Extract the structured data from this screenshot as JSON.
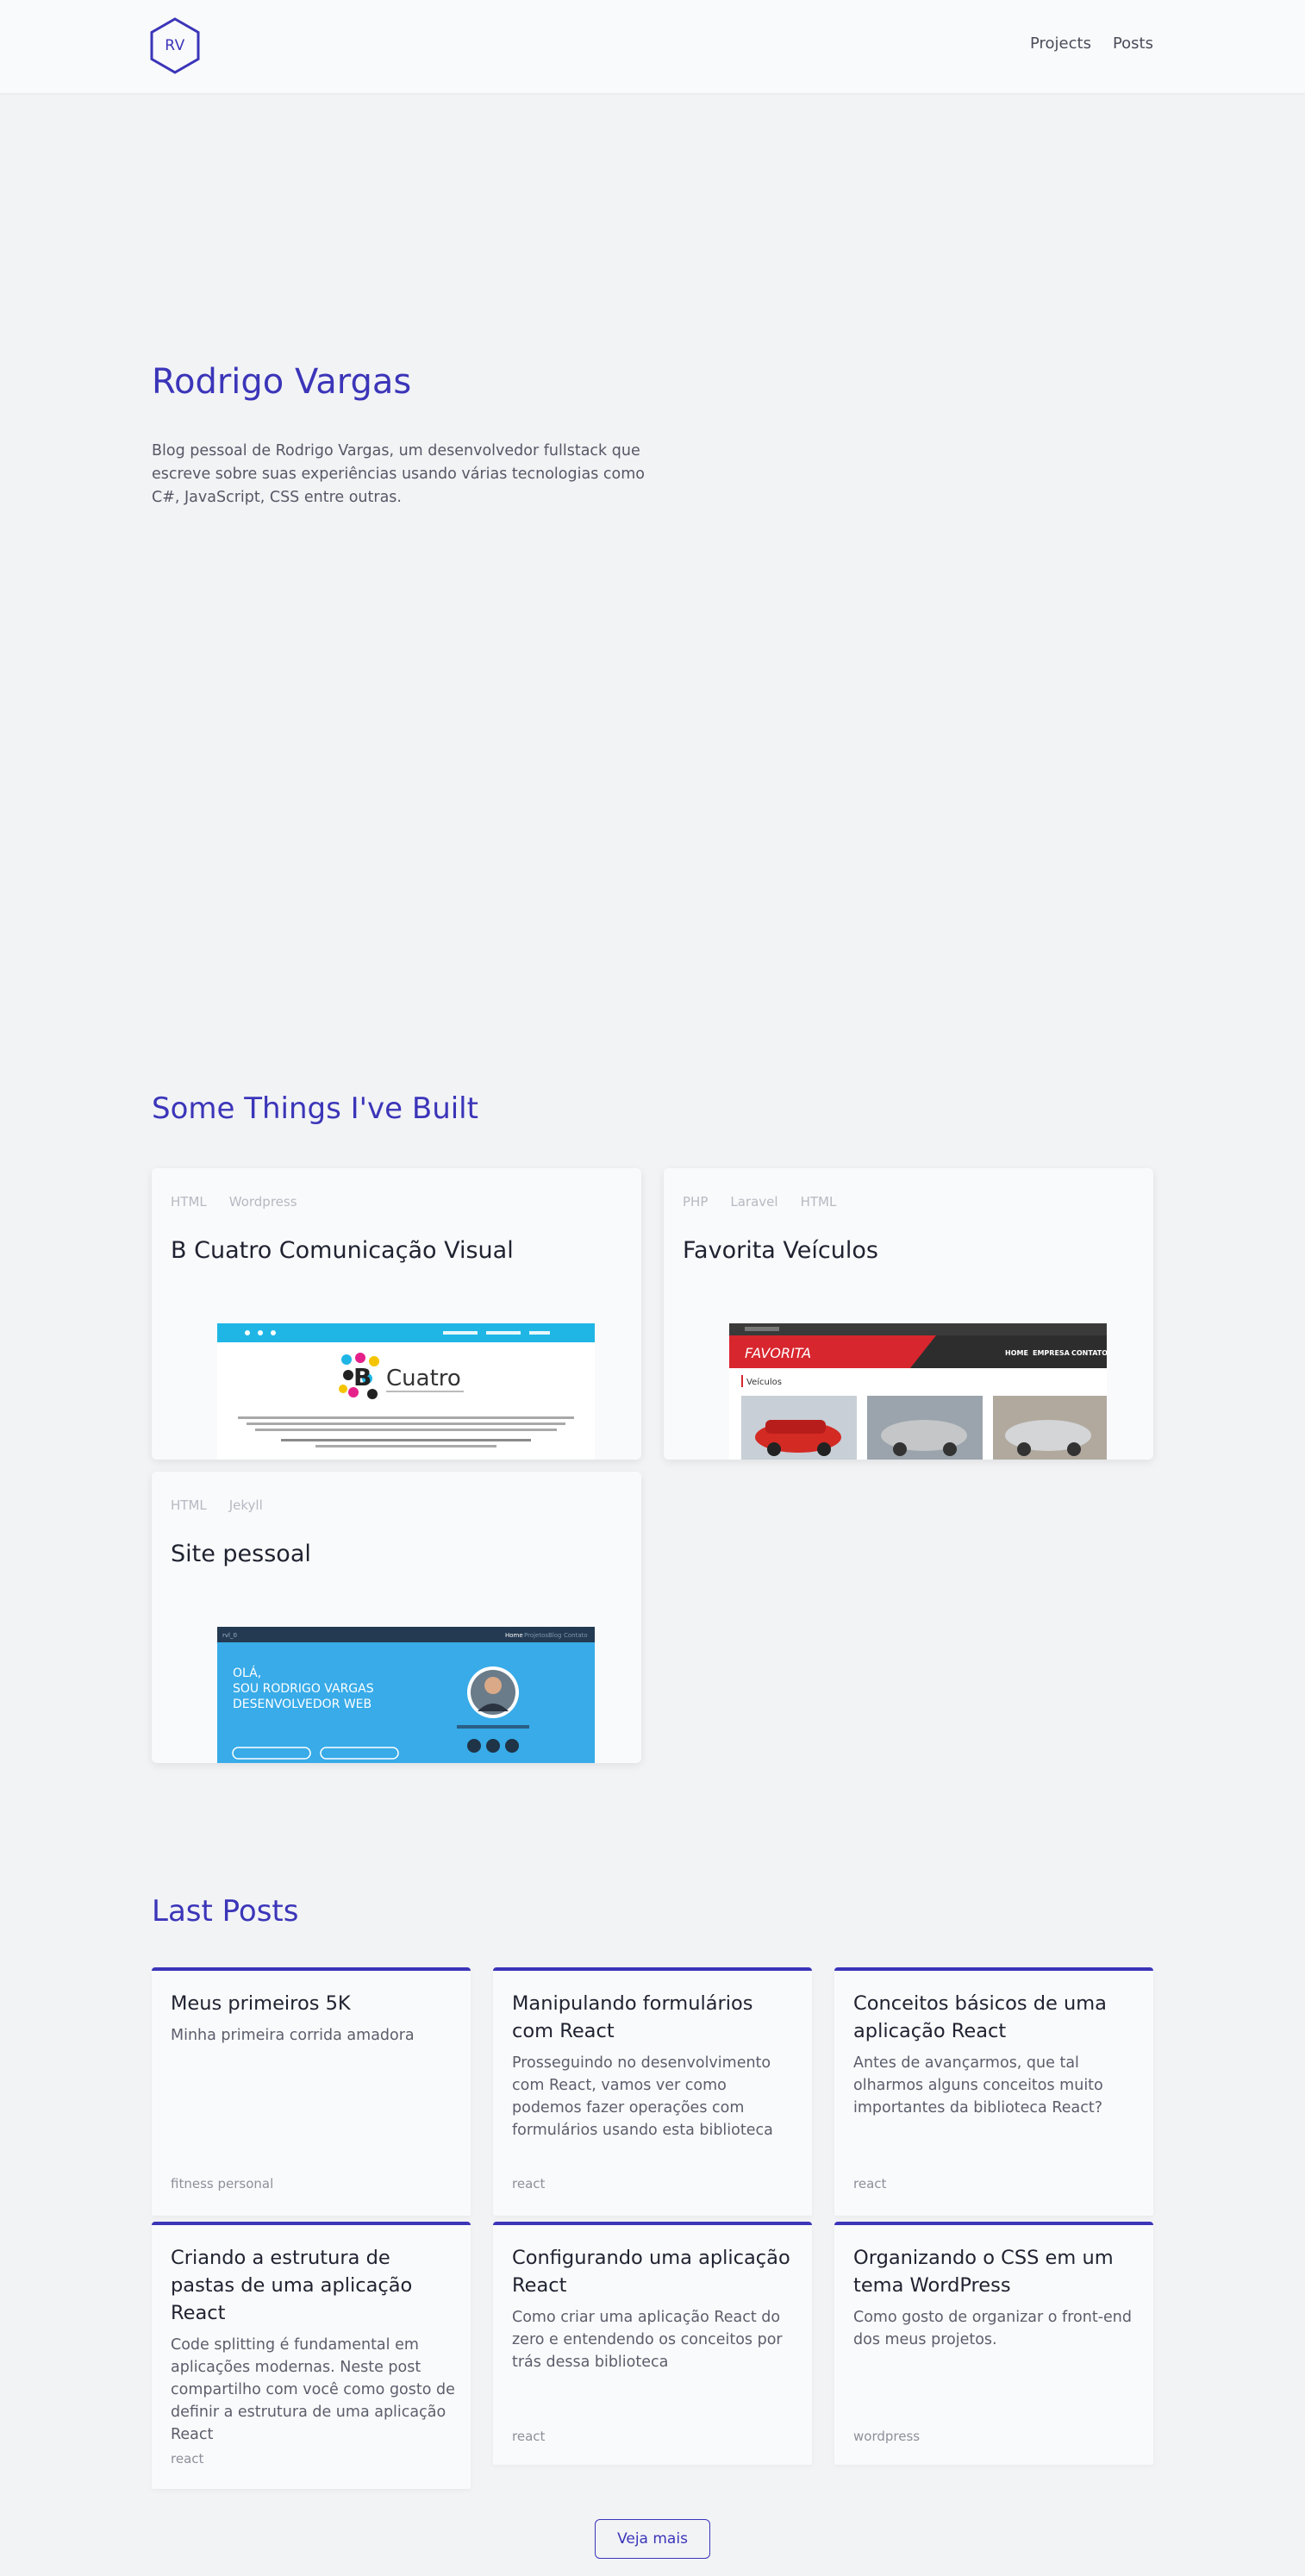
{
  "header": {
    "logo_text": "RV",
    "nav": [
      "Projects",
      "Posts"
    ]
  },
  "hero": {
    "title": "Rodrigo Vargas",
    "description": "Blog pessoal de Rodrigo Vargas, um desenvolvedor fullstack que escreve sobre suas experiências usando várias tecnologias como C#, JavaScript, CSS entre outras."
  },
  "projects": {
    "title": "Some Things I've Built",
    "items": [
      {
        "tags": [
          "HTML",
          "Wordpress"
        ],
        "title": "B Cuatro Comunicação Visual"
      },
      {
        "tags": [
          "PHP",
          "Laravel",
          "HTML"
        ],
        "title": "Favorita Veículos"
      },
      {
        "tags": [
          "HTML",
          "Jekyll"
        ],
        "title": "Site pessoal"
      }
    ]
  },
  "posts": {
    "title": "Last Posts",
    "items": [
      {
        "title": "Meus primeiros 5K",
        "description": "Minha primeira corrida amadora",
        "tag": "fitness personal"
      },
      {
        "title": "Manipulando formulários com React",
        "description": "Prosseguindo no desenvolvimento com React, vamos ver como podemos fazer operações com formulários usando esta biblioteca",
        "tag": "react"
      },
      {
        "title": "Conceitos básicos de uma aplicação React",
        "description": "Antes de avançarmos, que tal olharmos alguns conceitos muito importantes da biblioteca React?",
        "tag": "react"
      },
      {
        "title": "Criando a estrutura de pastas de uma aplicação React",
        "description": "Code splitting é fundamental em aplicações modernas. Neste post compartilho com você como gosto de definir a estrutura de uma aplicação React",
        "tag": "react"
      },
      {
        "title": "Configurando uma aplicação React",
        "description": "Como criar uma aplicação React do zero e entendendo os conceitos por trás dessa biblioteca",
        "tag": "react"
      },
      {
        "title": "Organizando o CSS em um tema WordPress",
        "description": "Como gosto de organizar o front-end dos meus projetos.",
        "tag": "wordpress"
      }
    ],
    "more_label": "Veja mais"
  },
  "screenshots": {
    "bcuatro": {
      "brand": "Cuatro"
    },
    "favorita": {
      "brand": "FAVORITA",
      "menu": [
        "HOME",
        "EMPRESA",
        "CONTATO"
      ],
      "section": "Veículos"
    },
    "site": {
      "logo": "rvl_0",
      "nav": [
        "Home",
        "Projetos",
        "Blog",
        "Contato"
      ],
      "headline": [
        "OLÁ,",
        "SOU RODRIGO VARGAS",
        "DESENVOLVEDOR WEB"
      ]
    }
  },
  "colors": {
    "accent": "#3b35b9",
    "background": "#f2f3f5",
    "card": "#f9fafb"
  }
}
